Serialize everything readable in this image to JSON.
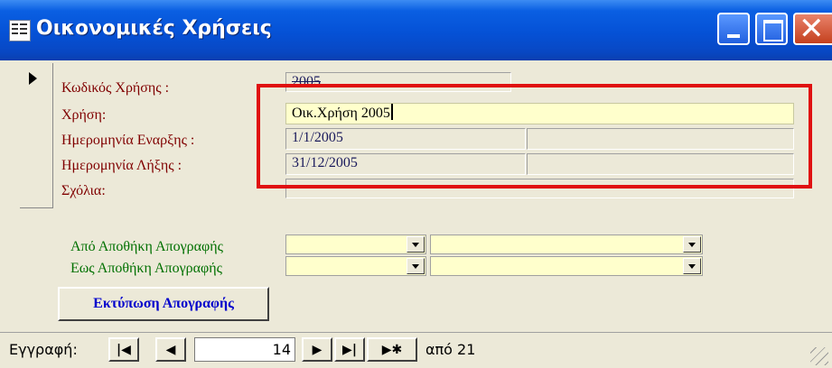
{
  "window": {
    "title": "Οικονομικές Χρήσεις",
    "icon": "form-icon",
    "controls": [
      "minimize-icon",
      "maximize-icon",
      "close-icon"
    ]
  },
  "form": {
    "code_label": "Κωδικός Χρήσης :",
    "code_value": "2005",
    "usage_label": "Χρήση:",
    "usage_value": "Οικ.Χρήση 2005",
    "start_label": "Ημερομηνία Εναρξης :",
    "start_value": "1/1/2005",
    "end_label": "Ημερομηνία Λήξης :",
    "end_value": "31/12/2005",
    "notes_label": "Σχόλια:",
    "notes_value": "",
    "from_warehouse_label": "Από Αποθήκη Απογραφής",
    "to_warehouse_label": "Εως Αποθήκη Απογραφής",
    "print_button": "Εκτύπωση Απογραφής"
  },
  "navigation": {
    "label": "Εγγραφή:",
    "current": "14",
    "of_label": "από 21",
    "first_glyph": "|◀",
    "prev_glyph": "◀",
    "next_glyph": "▶",
    "last_glyph": "▶|",
    "new_glyph": "▶✱"
  },
  "colors": {
    "titlebar": "#0551d6",
    "label_red": "#800000",
    "label_green": "#007000",
    "highlight": "#e01010",
    "field_yellow": "#ffffcc"
  }
}
